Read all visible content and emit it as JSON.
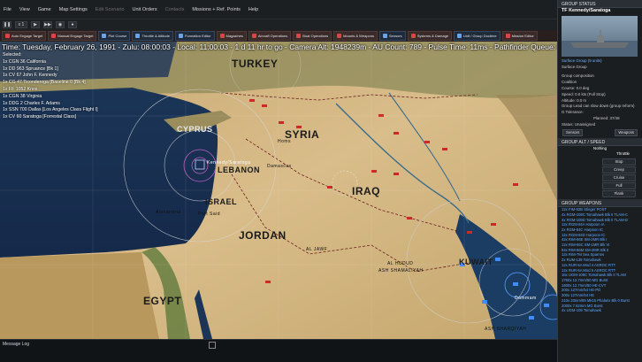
{
  "menubar": {
    "items": [
      "File",
      "View",
      "Game",
      "Map Settings",
      "Edit Scenario",
      "Unit Orders",
      "Contacts",
      "Missions + Ref. Points",
      "Help"
    ]
  },
  "controls": {
    "speed": "x 1"
  },
  "toolbar": {
    "buttons": [
      "Auto Engage Target",
      "Manual Engage Target",
      "Plot Course",
      "Throttle & Altitude",
      "Formation Editor",
      "Magazines",
      "Aircraft Operations",
      "Boat Operations",
      "Mounts & Weapons",
      "Sensors",
      "Systems & Damage",
      "Unit / Group Doctrine",
      "Mission Editor"
    ]
  },
  "status": {
    "line": "Time: Tuesday, February 26, 1991 - Zulu: 08:00:03 - Local: 11:00:03 - 1 d 11 hr to go -  Camera Alt: 1948239m - AU Count: 789 - Pulse Time: 11ms - Pathfinder Queue: 0"
  },
  "selected": {
    "header": "Selected:",
    "units": [
      "1x CGN 36 California",
      "1x DD 963 Spruance [Bk 1]",
      "1x CV 67 John F. Kennedy",
      "1x CG 47 Ticonderoga [Baseline 0 [Bk 4]",
      "1x FF 1052 Knox",
      "1x CGN 38 Virginia",
      "1x DDG 2 Charles F. Adams",
      "1x SSN 700 Dallas [Los Angeles Class Flight I]",
      "1x CV 60 Saratoga [Forrestal Class]"
    ]
  },
  "map": {
    "labels": {
      "turkey": "TURKEY",
      "syria": "SYRIA",
      "cyprus": "CYPRUS",
      "lebanon": "LEBANON",
      "israel": "ISRAEL",
      "jordan": "JORDAN",
      "iraq": "IRAQ",
      "egypt": "EGYPT",
      "kuwait": "KUWAIT",
      "damascus": "Damascus",
      "homs": "Homs",
      "alexandria": "Alexandria",
      "port_said": "Port Said",
      "al_jawf": "AL JAWF",
      "al_hudud": "AL HUDUD",
      "ash_shamaliyah": "ASH SHAMALIYAH",
      "ash_sharqiyah": "ASH SHARQIYAH",
      "group_marker": "Kennedy/Saratoga",
      "dammam": "Dammam"
    }
  },
  "msglog": {
    "title": "Message Log"
  },
  "sidebar": {
    "group_status": "GROUP STATUS",
    "group_name": "TF Kennedy/Saratoga",
    "group_link": "Surface Group (9 units)",
    "group_type": "Surface Group",
    "composition": "Group composition",
    "coalition": "Coalition",
    "course": "Course: 0.0 deg",
    "speed": "Speed: 0.0 kts (Full Stop)",
    "altitude": "Altitude: 0.0 m",
    "lead_slow": "Group Lead can slow down (group reform)",
    "g_tolerance": "G Tolerance:",
    "planned": "Planned: 37/48",
    "status_label": "Status: Unassigned",
    "sensors_btn": "Sensors",
    "weapons_btn": "Weapons",
    "alt_speed": "GROUP ALT / SPEED",
    "nothing": "Nothing",
    "throttle": "Throttle",
    "throttle_opts": [
      "Stop",
      "Creep",
      "Cruise",
      "Full",
      "Flank"
    ],
    "group_weapons": "GROUP WEAPONS",
    "weapons": [
      "12x FIM-92B Stinger POST",
      "4x RGM-109C Tomahawk Blk II TLAM-C",
      "4x RGM-109D Tomahawk Blk II TLAM-D",
      "12x RGM-84A Harpoon IA",
      "2x RGM-84C Harpoon IC",
      "12x RGM-84D Harpoon IC",
      "42x RIM-66E SM-2MR Blk I",
      "12x RIM-66C SM-1MR Blk VI",
      "84x RIM-66M SM-2MR Blk II",
      "12x RIM-7M Sea Sparrow",
      "2x RUM-139 Tomahawk",
      "12x RUR-5A Mod 4 ASROC RTT",
      "12x RUR-5A Mod 5 ASROC RTT",
      "16x UGM-109C Tomahawk Blk II TLAM",
      "1760x 12.7mm/50 MG Burst",
      "1600x 12.7mm/50 HE-CVT",
      "200x 127mm/54 HE-PD",
      "200x 127mm/54 HE",
      "210x 20mm/85 Mk15 Phalanx Blk 0 Burst",
      "2000x 7.62mm MG Burst",
      "4x UGM-109 Tomahawk"
    ]
  }
}
